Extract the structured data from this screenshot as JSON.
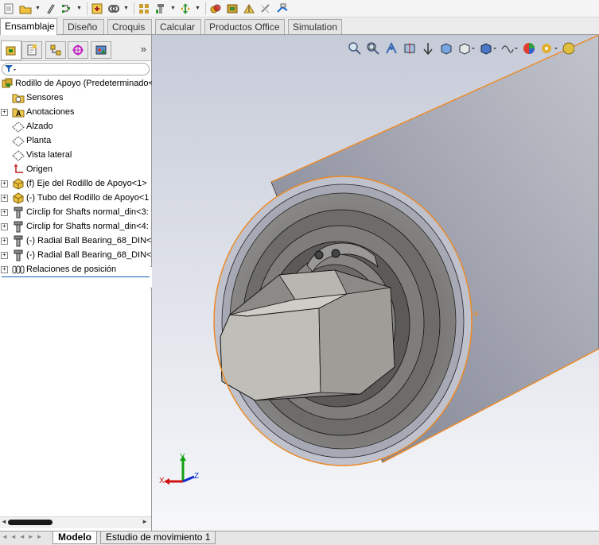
{
  "command_tabs": [
    {
      "label": "Ensamblaje",
      "active": true
    },
    {
      "label": "Diseño",
      "active": false
    },
    {
      "label": "Croquis",
      "active": false
    },
    {
      "label": "Calcular",
      "active": false
    },
    {
      "label": "Productos Office",
      "active": false
    },
    {
      "label": "Simulation",
      "active": false
    }
  ],
  "panel_tabs": [
    {
      "icon": "feature-manager-icon",
      "active": true
    },
    {
      "icon": "property-manager-icon",
      "active": false
    },
    {
      "icon": "configuration-manager-icon",
      "active": false
    },
    {
      "icon": "dimxpert-icon",
      "active": false
    },
    {
      "icon": "display-manager-icon",
      "active": false
    }
  ],
  "tree": [
    {
      "label": "Rodillo de Apoyo  (Predeterminado<",
      "icon": "assembly-icon",
      "level": 0,
      "expander": ""
    },
    {
      "label": "Sensores",
      "icon": "sensor-folder-icon",
      "level": 1,
      "expander": ""
    },
    {
      "label": "Anotaciones",
      "icon": "annotation-icon",
      "level": 1,
      "expander": "+"
    },
    {
      "label": "Alzado",
      "icon": "plane-icon",
      "level": 1,
      "expander": ""
    },
    {
      "label": "Planta",
      "icon": "plane-icon",
      "level": 1,
      "expander": ""
    },
    {
      "label": "Vista lateral",
      "icon": "plane-icon",
      "level": 1,
      "expander": ""
    },
    {
      "label": "Origen",
      "icon": "origin-icon",
      "level": 1,
      "expander": ""
    },
    {
      "label": "(f) Eje del Rodillo de Apoyo<1>",
      "icon": "part-icon",
      "level": 1,
      "expander": "+"
    },
    {
      "label": "(-) Tubo del Rodillo de Apoyo<1",
      "icon": "part-icon",
      "level": 1,
      "expander": "+"
    },
    {
      "label": "Circlip for Shafts normal_din<3:",
      "icon": "toolbox-part-icon",
      "level": 1,
      "expander": "+"
    },
    {
      "label": "Circlip for Shafts normal_din<4:",
      "icon": "toolbox-part-icon",
      "level": 1,
      "expander": "+"
    },
    {
      "label": "(-) Radial Ball Bearing_68_DIN<",
      "icon": "toolbox-part-icon",
      "level": 1,
      "expander": "+"
    },
    {
      "label": "(-) Radial Ball Bearing_68_DIN<",
      "icon": "toolbox-part-icon",
      "level": 1,
      "expander": "+"
    },
    {
      "label": "Relaciones de posición",
      "icon": "mates-icon",
      "level": 1,
      "expander": "+"
    }
  ],
  "bottom_tabs": [
    {
      "label": "Modelo",
      "active": true
    },
    {
      "label": "Estudio de movimiento 1",
      "active": false
    }
  ],
  "triad": {
    "x_label": "X",
    "y_label": "Y",
    "z_label": "Z"
  },
  "colors": {
    "selection": "#f08a24",
    "triad_x": "#d01010",
    "triad_y": "#10a010",
    "triad_z": "#1030d0"
  }
}
